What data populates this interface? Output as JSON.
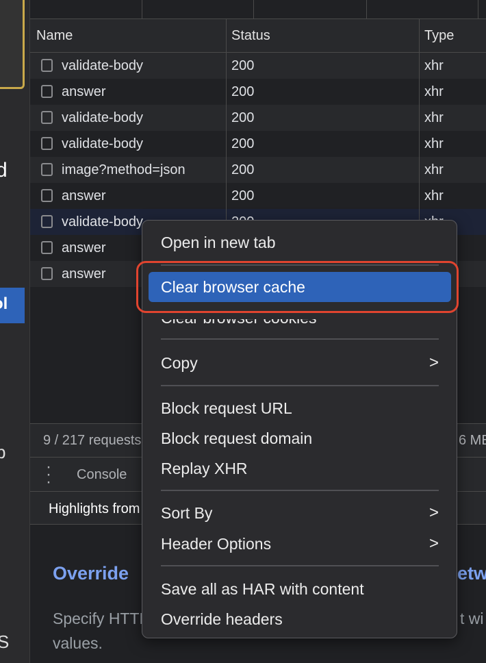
{
  "page_fragments": {
    "a": "d",
    "b": "ol",
    "c": "b",
    "d": "S"
  },
  "table": {
    "columns": [
      "Name",
      "Status",
      "Type"
    ],
    "rows": [
      {
        "name": "validate-body",
        "status": "200",
        "type": "xhr"
      },
      {
        "name": "answer",
        "status": "200",
        "type": "xhr"
      },
      {
        "name": "validate-body",
        "status": "200",
        "type": "xhr"
      },
      {
        "name": "validate-body",
        "status": "200",
        "type": "xhr"
      },
      {
        "name": "image?method=json",
        "status": "200",
        "type": "xhr"
      },
      {
        "name": "answer",
        "status": "200",
        "type": "xhr"
      },
      {
        "name": "validate-body",
        "status": "200",
        "type": "xhr",
        "selected": true
      },
      {
        "name": "answer",
        "status": "",
        "type": ""
      },
      {
        "name": "answer",
        "status": "",
        "type": ""
      }
    ]
  },
  "footer": {
    "requests": "9 / 217 requests",
    "size": "6 MB"
  },
  "drawer": {
    "more_icon": "vertical-dots-icon",
    "tab": "Console",
    "highlights": "Highlights from"
  },
  "content": {
    "heading_left": "Override",
    "heading_right": "etw",
    "text_left": "Specify HTTP",
    "text_right": "t wi",
    "text_line2": "values."
  },
  "context_menu": {
    "items": [
      "Open in new tab",
      "Clear browser cache",
      "Clear browser cookies",
      "Copy",
      "Block request URL",
      "Block request domain",
      "Replay XHR",
      "Sort By",
      "Header Options",
      "Save all as HAR with content",
      "Override headers"
    ],
    "highlighted": "Clear browser cache",
    "submenu_icon": "chevron-right-icon"
  },
  "colors": {
    "highlight": "#2e63b8",
    "annotation": "#e0442f",
    "link": "#7ca1ef"
  }
}
